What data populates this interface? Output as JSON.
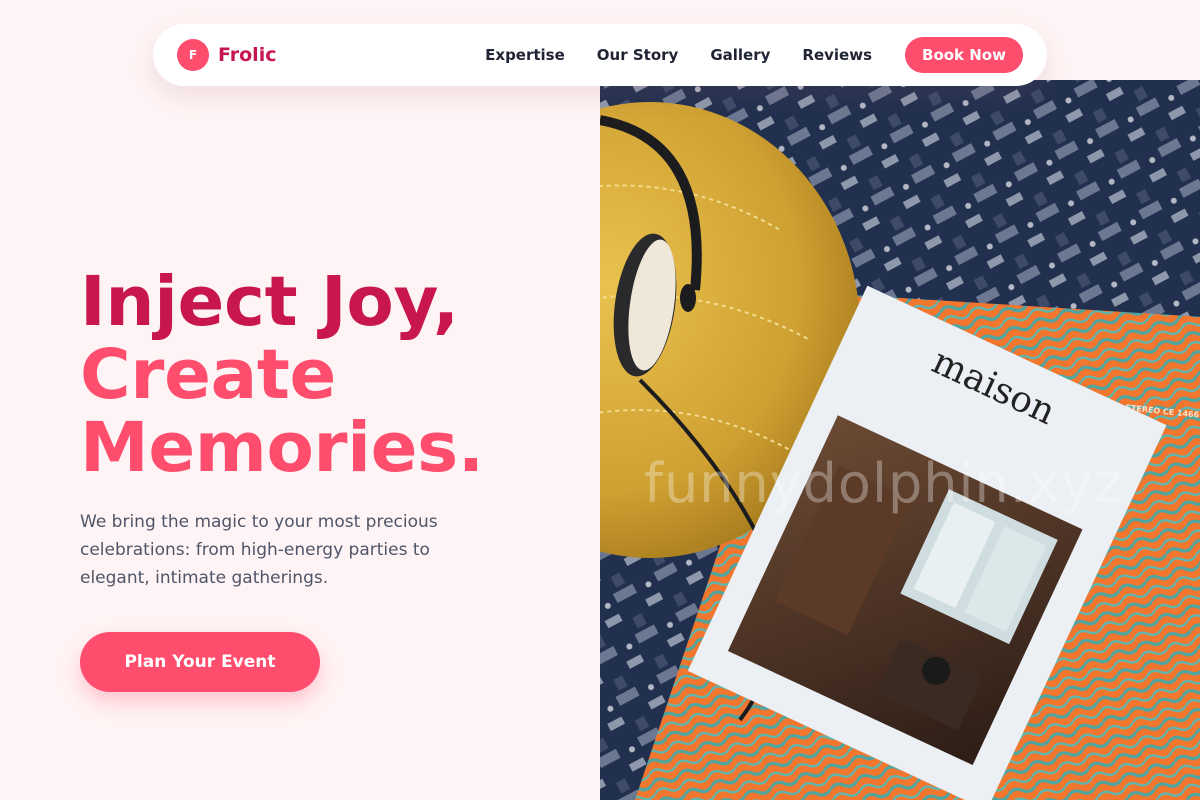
{
  "brand": {
    "logo_letter": "F",
    "name": "Frolic"
  },
  "nav": {
    "links": [
      "Expertise",
      "Our Story",
      "Gallery",
      "Reviews"
    ],
    "cta": "Book Now"
  },
  "hero": {
    "title_line1": "Inject Joy,",
    "title_line2": "Create",
    "title_line3": "Memories.",
    "description": "We bring the magic to your most precious celebrations: from high-energy parties to elegant, intimate gatherings.",
    "cta": "Plan Your Event"
  },
  "image": {
    "magazine_title": "maison",
    "record_label": "STEREO CE 1466",
    "watermark": "funnydolphin.xyz"
  },
  "colors": {
    "primary": "#ff4d6d",
    "primary_dark": "#c8174f",
    "background": "#fff4f5",
    "text": "#1f2333",
    "muted": "#4e5568"
  }
}
